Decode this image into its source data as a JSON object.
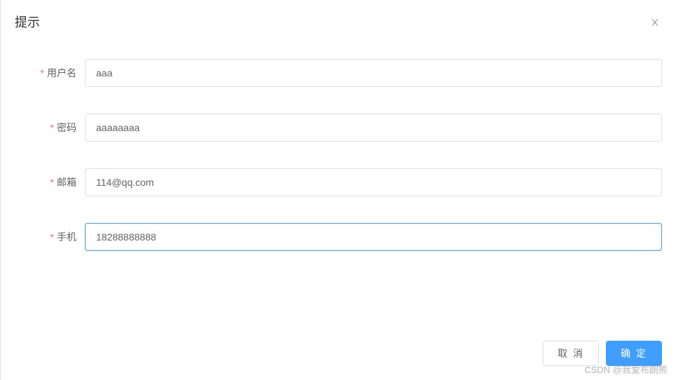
{
  "dialog": {
    "title": "提示",
    "form": {
      "username": {
        "label": "用户名",
        "value": "aaa"
      },
      "password": {
        "label": "密码",
        "value": "aaaaaaaa"
      },
      "email": {
        "label": "邮箱",
        "value": "114@qq.com"
      },
      "phone": {
        "label": "手机",
        "value": "18288888888"
      }
    },
    "footer": {
      "cancel": "取 消",
      "confirm": "确 定"
    }
  },
  "watermark": "CSDN @我爱布朗熊"
}
